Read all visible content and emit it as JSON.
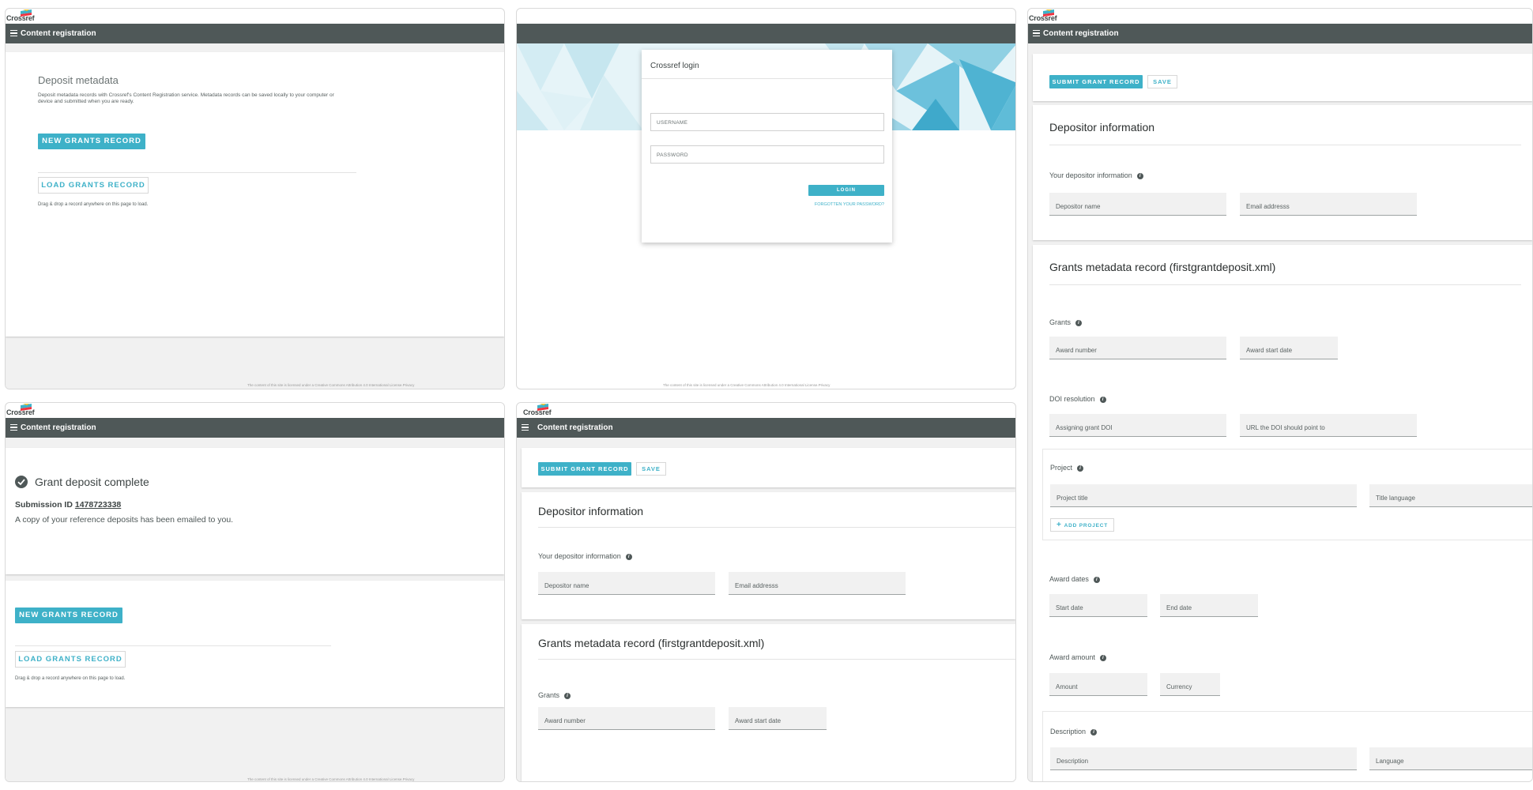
{
  "brand": {
    "logo_text": "Crossref",
    "colors": {
      "accent": "#3eb1c8",
      "appbar": "#4f5858",
      "logo_red": "#ef3340",
      "logo_yellow": "#ffc72c"
    }
  },
  "appbar_title": "Content registration",
  "footer_text": "The content of this site is licensed under a Creative Commons Attribution 4.0 International License.Privacy",
  "deposit": {
    "heading": "Deposit metadata",
    "description": "Deposit metadata records with Crossref's Content Registration service. Metadata records can be saved locally to your computer or device and submitted when you are ready.",
    "new_button": "NEW GRANTS RECORD",
    "load_button": "LOAD GRANTS RECORD",
    "drag_hint": "Drag & drop a record anywhere on this page to load."
  },
  "login": {
    "title": "Crossref login",
    "username_placeholder": "USERNAME",
    "password_placeholder": "PASSWORD",
    "login_button": "LOGIN",
    "forgot_link": "FORGOTTEN YOUR PASSWORD?"
  },
  "complete": {
    "heading": "Grant deposit complete",
    "submission_label": "Submission ID",
    "submission_id": "1478723338",
    "message": "A copy of your reference deposits has been emailed to you."
  },
  "form": {
    "submit_button": "SUBMIT GRANT RECORD",
    "save_button": "SAVE",
    "depositor_heading": "Depositor information",
    "your_depositor_label": "Your depositor information",
    "depositor_name": "Depositor name",
    "email_address": "Email addresss",
    "grants_record_heading": "Grants metadata record (firstgrantdeposit.xml)",
    "grants_label": "Grants",
    "award_number": "Award number",
    "award_start_date": "Award start date",
    "doi_resolution_label": "DOI resolution",
    "assigning_doi": "Assigning grant DOI",
    "doi_url": "URL the DOI should point to",
    "project_label": "Project",
    "project_title": "Project title",
    "title_language": "Title language",
    "add_project": "ADD PROJECT",
    "award_dates_label": "Award dates",
    "start_date": "Start date",
    "end_date": "End date",
    "award_amount_label": "Award amount",
    "amount": "Amount",
    "currency": "Currency",
    "description_label": "Description",
    "description": "Description",
    "language": "Language"
  }
}
